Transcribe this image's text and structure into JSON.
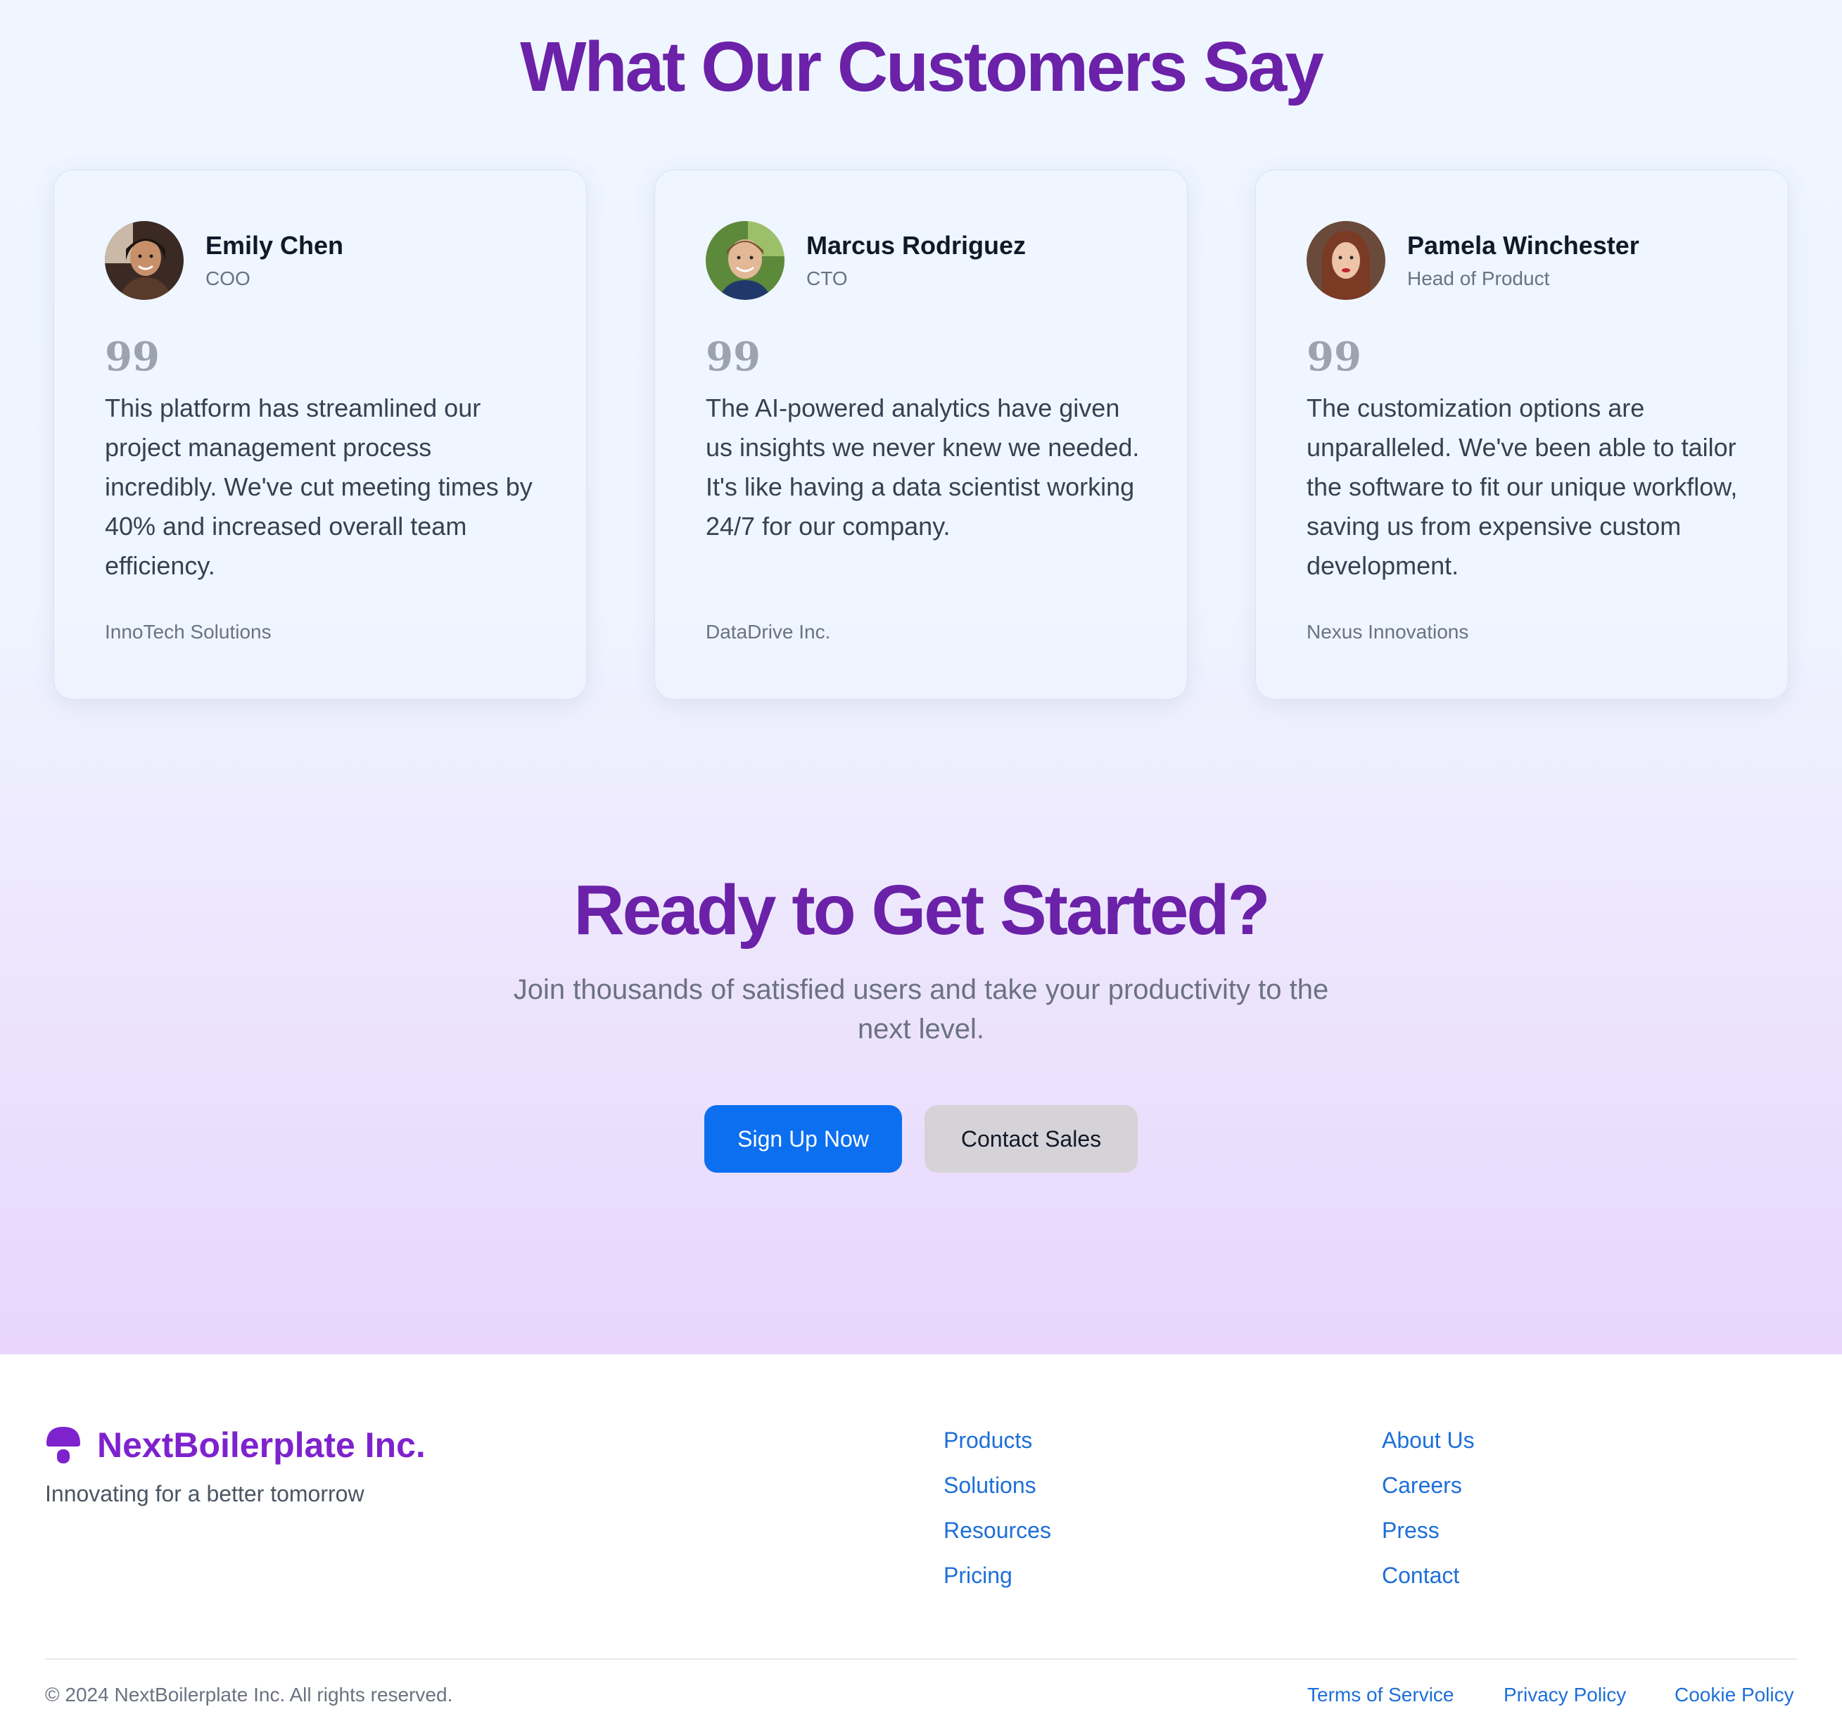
{
  "testimonials": {
    "heading": "What Our Customers Say",
    "quote_glyph": "99",
    "cards": [
      {
        "name": "Emily Chen",
        "role": "COO",
        "quote": "This platform has streamlined our project management process incredibly. We've cut meeting times by 40% and increased overall team efficiency.",
        "company": "InnoTech Solutions"
      },
      {
        "name": "Marcus Rodriguez",
        "role": "CTO",
        "quote": "The AI-powered analytics have given us insights we never knew we needed. It's like having a data scientist working 24/7 for our company.",
        "company": "DataDrive Inc."
      },
      {
        "name": "Pamela Winchester",
        "role": "Head of Product",
        "quote": "The customization options are unparalleled. We've been able to tailor the software to fit our unique workflow, saving us from expensive custom development.",
        "company": "Nexus Innovations"
      }
    ]
  },
  "cta": {
    "heading": "Ready to Get Started?",
    "subtitle": "Join thousands of satisfied users and take your productivity to the next level.",
    "primary_label": "Sign Up Now",
    "secondary_label": "Contact Sales"
  },
  "footer": {
    "brand": "NextBoilerplate Inc.",
    "tagline": "Innovating for a better tomorrow",
    "col1": [
      "Products",
      "Solutions",
      "Resources",
      "Pricing"
    ],
    "col2": [
      "About Us",
      "Careers",
      "Press",
      "Contact"
    ],
    "copyright": "© 2024 NextBoilerplate Inc. All rights reserved.",
    "legal": [
      "Terms of Service",
      "Privacy Policy",
      "Cookie Policy"
    ]
  },
  "colors": {
    "heading": "#6b21a8",
    "primary_button": "#0b6ff0",
    "link": "#1d6fd8",
    "brand": "#7e22ce"
  }
}
